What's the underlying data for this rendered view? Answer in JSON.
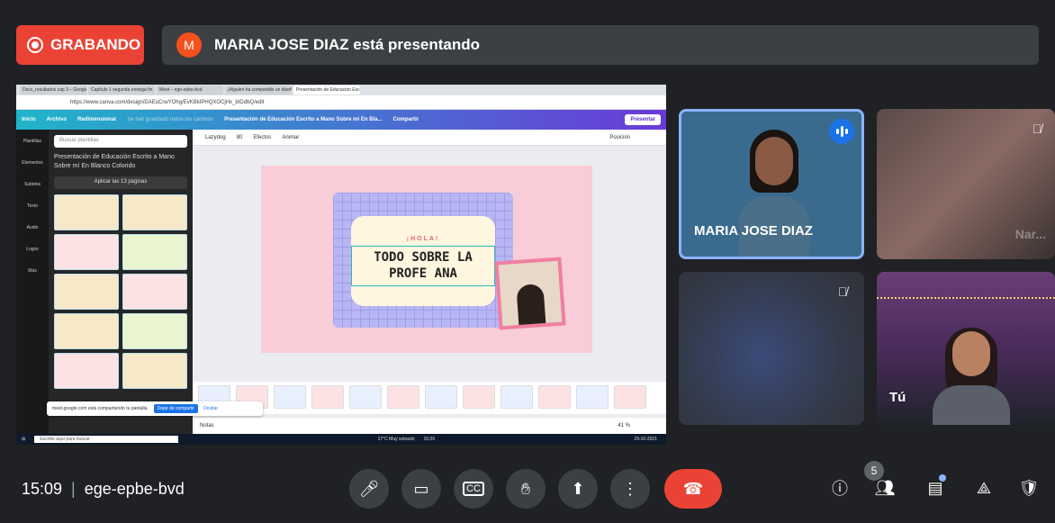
{
  "recording": {
    "label": "GRABANDO"
  },
  "presenter": {
    "initial": "M",
    "text": "MARIA JOSE DIAZ está presentando"
  },
  "shared": {
    "tabs": [
      "Docs_resultados cap 3 – Google",
      "Capítulo 1 segunda entrega fin",
      "Meet – ege-epbe-bvd",
      "¡Alguien ha compartido un diseño",
      "Presentación de Educación Escri"
    ],
    "url": "https://www.canva.com/design/DAEuCrwYOhg/EvKBkIPHQXOCjHx_bIDdbQ/edit",
    "canva_menu": [
      "Inicio",
      "Archivo",
      "Redimensionar"
    ],
    "canva_saved": "Se han guardado todos los cambios",
    "canva_title": "Presentación de Educación Escrito a Mano Sobre mí En Bla...",
    "canva_share": "Compartir",
    "canva_present": "Presentar",
    "side_labels": [
      "Plantillas",
      "Elementos",
      "Subidos",
      "Texto",
      "Audio",
      "Logos",
      "Más"
    ],
    "search_placeholder": "Buscar plantillas",
    "template_title": "Presentación de Educación Escrito a Mano Sobre mí En Blanco Colorido",
    "apply_label": "Aplicar las 13 páginas",
    "font": "Lazydog",
    "font_size": "80",
    "effects": "Efectos",
    "animate": "Animar",
    "position": "Posición",
    "slide_hola": "¡HOLA!",
    "slide_title": "TODO SOBRE LA PROFE ANA",
    "share_notice": "meet.google.com está compartiendo tu pantalla.",
    "stop_share": "Dejar de compartir",
    "hide": "Ocultar",
    "notes": "Notas",
    "zoom": "41 %",
    "taskbar_search": "Escribe aquí para buscar",
    "weather": "17°C Muy soleado",
    "time_small": "15:09",
    "date_small": "29-10-2021"
  },
  "participants": {
    "main_name": "MARIA JOSE DIAZ",
    "blur_name": "Nar...",
    "you_label": "Tú"
  },
  "meeting": {
    "time": "15:09",
    "separator": "|",
    "code": "ege-epbe-bvd",
    "participant_count": "5"
  },
  "colors": {
    "record": "#ea4335",
    "speaking": "#1a73e8",
    "end_call": "#ea4335"
  }
}
